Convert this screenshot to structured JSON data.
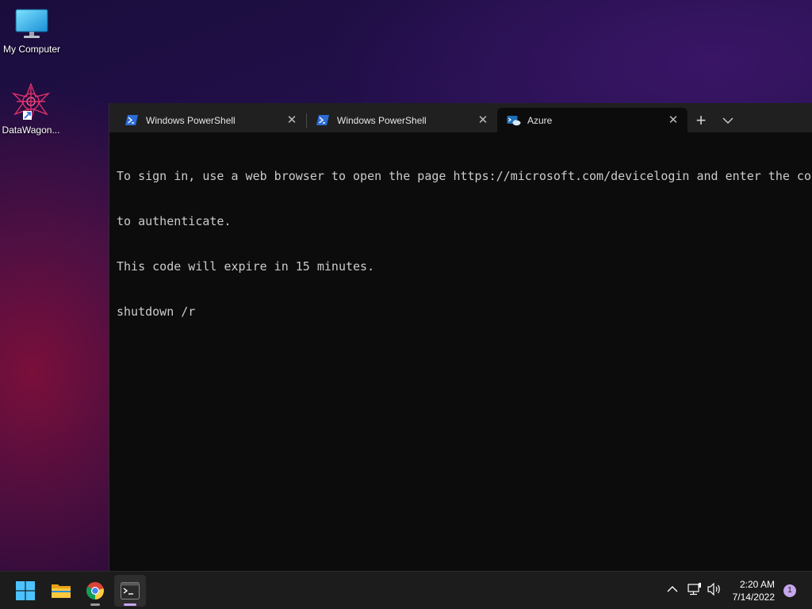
{
  "desktop": {
    "icons": [
      {
        "label": "My Computer",
        "icon": "monitor-icon"
      },
      {
        "label": "DataWagon...",
        "icon": "datawagon-logo-icon"
      }
    ]
  },
  "terminal": {
    "tabs": [
      {
        "title": "Windows PowerShell",
        "icon": "powershell-icon",
        "active": false
      },
      {
        "title": "Windows PowerShell",
        "icon": "powershell-icon",
        "active": false
      },
      {
        "title": "Azure",
        "icon": "azure-cloud-shell-icon",
        "active": true
      }
    ],
    "new_tab_label": "+",
    "dropdown_label": "⌄",
    "console_lines": [
      "To sign in, use a web browser to open the page https://microsoft.com/devicelogin and enter the code",
      "to authenticate.",
      "This code will expire in 15 minutes.",
      "shutdown /r"
    ]
  },
  "taskbar": {
    "apps": [
      "start-icon",
      "file-explorer-icon",
      "chrome-icon",
      "terminal-icon"
    ],
    "tray": [
      "chevron-up-icon",
      "network-icon",
      "volume-icon"
    ],
    "time": "2:20 AM",
    "date": "7/14/2022",
    "notification_count": "1"
  },
  "colors": {
    "terminal_bg": "#0c0c0c",
    "tabbar_bg": "#202020",
    "taskbar_bg": "#1c1c1c",
    "accent": "#c6a7ee"
  }
}
